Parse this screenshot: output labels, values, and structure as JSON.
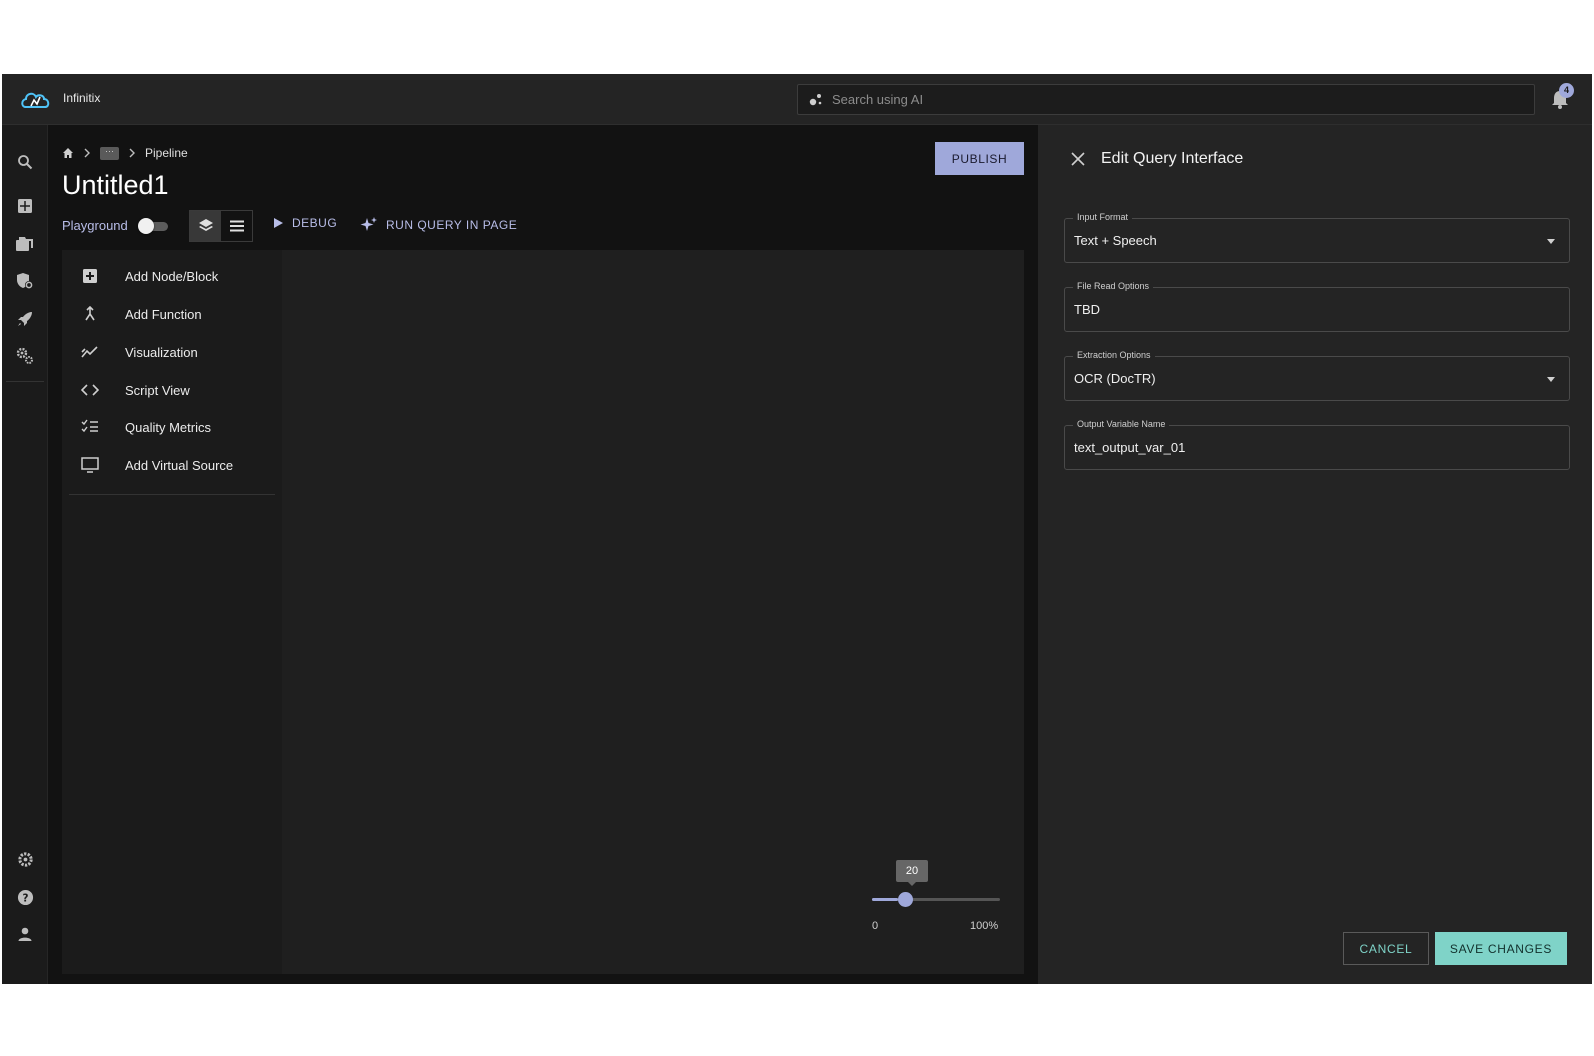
{
  "app": {
    "brand": "Infinitix",
    "accent_color": "#9fa8da",
    "teal_color": "#7fd3c8"
  },
  "search": {
    "placeholder": "Search using AI",
    "icon": "ai-sparkle-icon"
  },
  "notifications": {
    "count": "4",
    "icon": "bell-icon"
  },
  "rail": {
    "top_icons": [
      "search-icon",
      "dashboard-icon",
      "folders-icon",
      "security-icon",
      "rocket-icon",
      "gears-icon"
    ],
    "bottom_icons": [
      "settings-icon",
      "help-icon",
      "user-icon"
    ]
  },
  "breadcrumb": {
    "home_icon": "home-icon",
    "more": "···",
    "current": "Pipeline"
  },
  "page": {
    "title": "Untitled1",
    "publish_label": "PUBLISH"
  },
  "toolbar": {
    "playground_label": "Playground",
    "playground_on": false,
    "view_buttons": [
      "layers-icon",
      "list-icon"
    ],
    "debug_label": "DEBUG",
    "run_query_label": "RUN QUERY IN PAGE"
  },
  "menu": {
    "items": [
      {
        "label": "Add Node/Block",
        "icon": "add-box-icon"
      },
      {
        "label": "Add Function",
        "icon": "function-icon"
      },
      {
        "label": "Visualization",
        "icon": "chart-icon"
      },
      {
        "label": "Script View",
        "icon": "code-icon"
      },
      {
        "label": "Quality Metrics",
        "icon": "checklist-icon"
      },
      {
        "label": "Add Virtual Source",
        "icon": "monitor-icon"
      }
    ]
  },
  "slider": {
    "value": "20",
    "value_fraction": 0.2,
    "min_label": "0",
    "max_label": "100%"
  },
  "panel": {
    "title": "Edit Query Interface",
    "fields": [
      {
        "label": "Input Format",
        "value": "Text + Speech",
        "dropdown": true
      },
      {
        "label": "File Read Options",
        "value": "TBD",
        "dropdown": false
      },
      {
        "label": "Extraction Options",
        "value": "OCR (DocTR)",
        "dropdown": true
      },
      {
        "label": "Output Variable Name",
        "value": "text_output_var_01",
        "dropdown": false
      }
    ],
    "cancel_label": "CANCEL",
    "save_label": "SAVE CHANGES"
  }
}
